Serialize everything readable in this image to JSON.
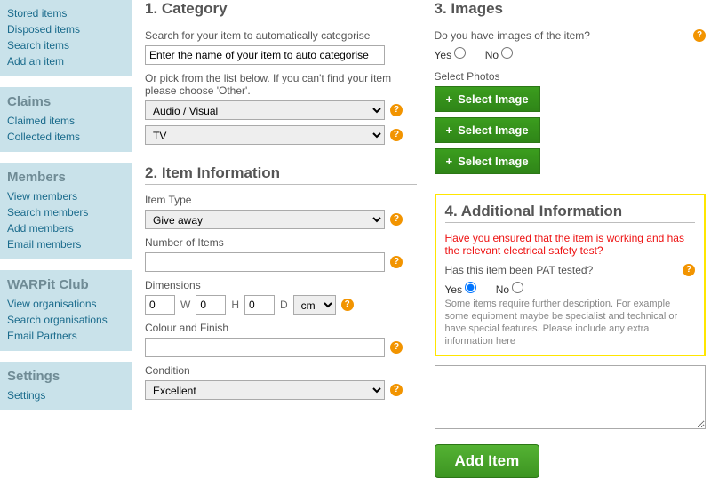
{
  "sidebar": {
    "g0": {
      "items": [
        "Stored items",
        "Disposed items",
        "Search items",
        "Add an item"
      ]
    },
    "g1": {
      "title": "Claims",
      "items": [
        "Claimed items",
        "Collected items"
      ]
    },
    "g2": {
      "title": "Members",
      "items": [
        "View members",
        "Search members",
        "Add members",
        "Email members"
      ]
    },
    "g3": {
      "title": "WARPit Club",
      "items": [
        "View organisations",
        "Search organisations",
        "Email Partners"
      ]
    },
    "g4": {
      "title": "Settings",
      "items": [
        "Settings"
      ]
    }
  },
  "category": {
    "heading": "1. Category",
    "search_label": "Search for your item to automatically categorise",
    "search_value": "Enter the name of your item to auto categorise",
    "or_text": "Or pick from the list below. If you can't find your item please choose 'Other'.",
    "sel1": "Audio / Visual",
    "sel2": "TV"
  },
  "info": {
    "heading": "2. Item Information",
    "type_label": "Item Type",
    "type_value": "Give away",
    "num_label": "Number of Items",
    "num_value": "",
    "dim_label": "Dimensions",
    "dim_w": "0",
    "dim_h": "0",
    "dim_d": "0",
    "dim_unit": "cm",
    "w": "W",
    "h": "H",
    "d": "D",
    "colour_label": "Colour and Finish",
    "colour_value": "",
    "cond_label": "Condition",
    "cond_value": "Excellent"
  },
  "images": {
    "heading": "3. Images",
    "q": "Do you have images of the item?",
    "yes": "Yes",
    "no": "No",
    "select_label": "Select Photos",
    "btn": "Select Image"
  },
  "add": {
    "heading": "4. Additional Information",
    "warn": "Have you ensured that the item is working and has the relevant electrical safety test?",
    "pat_q": "Has this item been PAT tested?",
    "yes": "Yes",
    "no": "No",
    "hint": "Some items require further description. For example some equipment maybe be specialist and technical or have special features. Please include any extra information here"
  },
  "submit": "Add Item",
  "help": "?"
}
